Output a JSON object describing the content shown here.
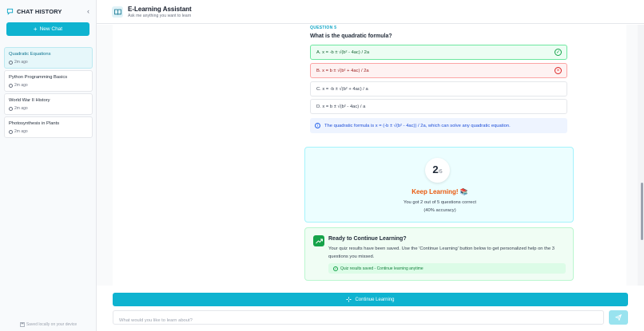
{
  "sidebar": {
    "title": "CHAT HISTORY",
    "collapse_icon": "chevron-left-icon",
    "new_chat_label": "New Chat",
    "chats": [
      {
        "title": "Quadratic Equations",
        "time": "2m ago",
        "active": true
      },
      {
        "title": "Python Programming Basics",
        "time": "2m ago",
        "active": false
      },
      {
        "title": "World War II History",
        "time": "2m ago",
        "active": false
      },
      {
        "title": "Photosynthesis in Plants",
        "time": "2m ago",
        "active": false
      }
    ],
    "footer": "Saved locally on your device"
  },
  "header": {
    "title": "E-Learning Assistant",
    "subtitle": "Ask me anything you want to learn"
  },
  "question": {
    "label": "QUESTION 5",
    "text": "What is the quadratic formula?",
    "options": [
      {
        "text": "A. x = -b ± √(b² - 4ac) / 2a",
        "state": "correct"
      },
      {
        "text": "B. x = b ± √(b² + 4ac) / 2a",
        "state": "wrong"
      },
      {
        "text": "C. x = -b ± √(b² + 4ac) / a",
        "state": "neutral"
      },
      {
        "text": "D. x = b ± √(b² - 4ac) / a",
        "state": "neutral"
      }
    ],
    "explanation": "The quadratic formula is x = (-b ± √(b² - 4ac)) / 2a, which can solve any quadratic equation."
  },
  "score": {
    "correct": "2",
    "total": "/5",
    "headline": "Keep Learning! 📚",
    "line1": "You got 2 out of 5 questions correct",
    "line2": "(40% accuracy)"
  },
  "ready": {
    "title": "Ready to Continue Learning?",
    "body": "Your quiz results have been saved. Use the 'Continue Learning' button below to get personalized help on the 3 questions you missed.",
    "saved_note": "Quiz results saved - Continue learning anytime"
  },
  "composer": {
    "continue_label": "Continue Learning",
    "placeholder": "What would you like to learn about?"
  },
  "colors": {
    "accent": "#0fb3d0",
    "correct": "#16a34a",
    "wrong": "#dc2626",
    "highlight": "#ea580c"
  }
}
